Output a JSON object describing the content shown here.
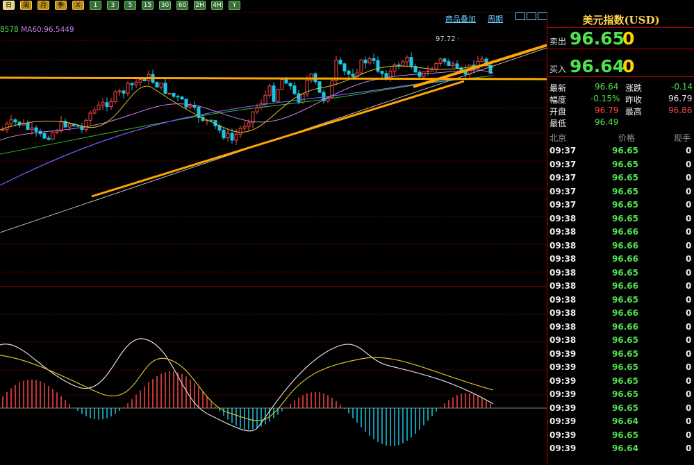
{
  "toolbar": {
    "periods": [
      "日",
      "周",
      "月",
      "季",
      "X",
      "1",
      "3",
      "5",
      "15",
      "30",
      "60",
      "2H",
      "4H",
      "Y"
    ]
  },
  "chart": {
    "ma_legend_left": "8578",
    "ma_legend_right": "MA60:96.5449",
    "link_overlay": "商品叠加",
    "link_period": "周期",
    "price_marker": "97.72 ·"
  },
  "quote": {
    "title": "美元指数(USD)",
    "sell_label": "卖出",
    "sell_price": "96.65",
    "sell_volume": "0",
    "buy_label": "买入",
    "buy_price": "96.64",
    "buy_volume": "0",
    "latest_label": "最新",
    "latest_value": "96.64",
    "change_label": "涨跌",
    "change_value": "-0.14",
    "amplitude_label": "幅度",
    "amplitude_value": "-0.15%",
    "prev_close_label": "昨收",
    "prev_close_value": "96.79",
    "open_label": "开盘",
    "open_value": "96.79",
    "high_label": "最高",
    "high_value": "96.86",
    "low_label": "最低",
    "low_value": "96.49"
  },
  "ticks": {
    "headers": [
      "北京",
      "价格",
      "现手"
    ],
    "rows": [
      {
        "time": "09:37",
        "price": "96.65",
        "vol": "0"
      },
      {
        "time": "09:37",
        "price": "96.65",
        "vol": "0"
      },
      {
        "time": "09:37",
        "price": "96.65",
        "vol": "0"
      },
      {
        "time": "09:37",
        "price": "96.65",
        "vol": "0"
      },
      {
        "time": "09:37",
        "price": "96.65",
        "vol": "0"
      },
      {
        "time": "09:38",
        "price": "96.65",
        "vol": "0"
      },
      {
        "time": "09:38",
        "price": "96.66",
        "vol": "0"
      },
      {
        "time": "09:38",
        "price": "96.66",
        "vol": "0"
      },
      {
        "time": "09:38",
        "price": "96.66",
        "vol": "0"
      },
      {
        "time": "09:38",
        "price": "96.65",
        "vol": "0"
      },
      {
        "time": "09:38",
        "price": "96.66",
        "vol": "0"
      },
      {
        "time": "09:38",
        "price": "96.65",
        "vol": "0"
      },
      {
        "time": "09:38",
        "price": "96.66",
        "vol": "0"
      },
      {
        "time": "09:38",
        "price": "96.66",
        "vol": "0"
      },
      {
        "time": "09:38",
        "price": "96.65",
        "vol": "0"
      },
      {
        "time": "09:39",
        "price": "96.65",
        "vol": "0"
      },
      {
        "time": "09:39",
        "price": "96.65",
        "vol": "0"
      },
      {
        "time": "09:39",
        "price": "96.65",
        "vol": "0"
      },
      {
        "time": "09:39",
        "price": "96.65",
        "vol": "0"
      },
      {
        "time": "09:39",
        "price": "96.65",
        "vol": "0"
      },
      {
        "time": "09:39",
        "price": "96.64",
        "vol": "0"
      },
      {
        "time": "09:39",
        "price": "96.65",
        "vol": "0"
      },
      {
        "time": "09:39",
        "price": "96.64",
        "vol": "0"
      }
    ]
  },
  "colors": {
    "up": "#ff4747",
    "down": "#19c8e6",
    "price_green": "#4fe24f",
    "accent_gold": "#ffd34c",
    "grid": "#6a0000"
  }
}
